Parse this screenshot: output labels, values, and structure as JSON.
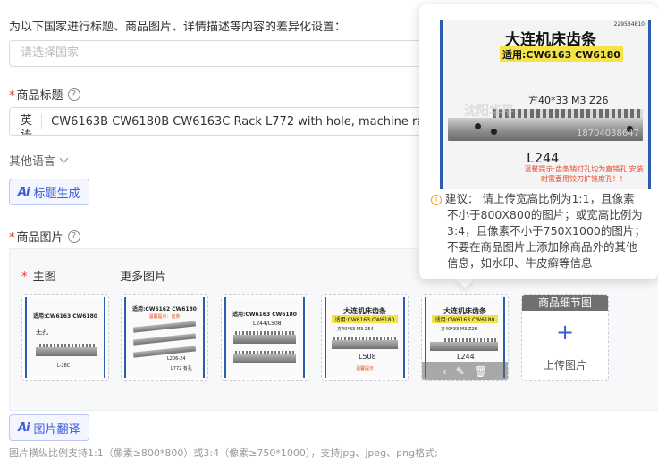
{
  "intro_text": "为以下国家进行标题、商品图片、详情描述等内容的差异化设置：",
  "country_select": {
    "placeholder": "请选择国家"
  },
  "title_section": {
    "label": "商品标题",
    "lang": "英语",
    "value": "CW6163B CW6180B CW6163C Rack L772 with hole, machine rack"
  },
  "other_languages": "其他语言",
  "title_gen_button": "标题生成",
  "image_section": {
    "label": "商品图片",
    "main_tab": "主图",
    "more_tab": "更多图片",
    "thumbs": [
      {
        "title": "适用:CW6163 CW6180",
        "sub": "",
        "label": "无孔",
        "spec": "L-28C",
        "warn": ""
      },
      {
        "title": "适用:CW6162 CW6180",
        "sub": "",
        "label": "L206-24",
        "spec": "L772 有孔",
        "warn": "温馨提示：齿条"
      },
      {
        "title": "适用:CW6163 CW6180",
        "sub": "",
        "label": "L244/L508",
        "spec": "",
        "warn": ""
      },
      {
        "title": "大连机床齿条",
        "sub": "适用:CW6163 CW6180",
        "label": "L508",
        "spec": "方40*33 M3 Z54",
        "warn": "温馨提示"
      },
      {
        "title": "大连机床齿条",
        "sub": "适用:CW6163 CW6180",
        "label": "L244",
        "spec": "方40*33 M3 Z26",
        "warn": ""
      }
    ],
    "detail_header": "商品细节图",
    "upload_label": "上传图片"
  },
  "image_translate_button": "图片翻译",
  "hint_text": "图片横纵比例支持1:1（像素≥800*800）或3:4（像素≥750*1000），支持jpg、jpeg、png格式;",
  "popover": {
    "image": {
      "title": "大连机床齿条",
      "subtitle": "适用:CW6163 CW6180",
      "spec": "方40*33  M3  Z26",
      "length": "L244",
      "warning": "温馨提示:齿条销钉孔均为直销孔 安装时需要用铰刀扩锥度孔！！",
      "phone": "18704038647",
      "phone_top": "229534810",
      "watermark": "沈阳华平"
    },
    "tip_lines": [
      "建议：  请上传宽高比例为1:1，且像素",
      "不小于800X800的图片；或宽高比例为",
      "3:4，且像素不小于750X1000的图片；",
      "不要在商品图片上添加除商品外的其他",
      "信息，如水印、牛皮癣等信息"
    ]
  },
  "colors": {
    "accent": "#3b5bdb",
    "required": "#e5342c",
    "warning": "#f0a020"
  }
}
